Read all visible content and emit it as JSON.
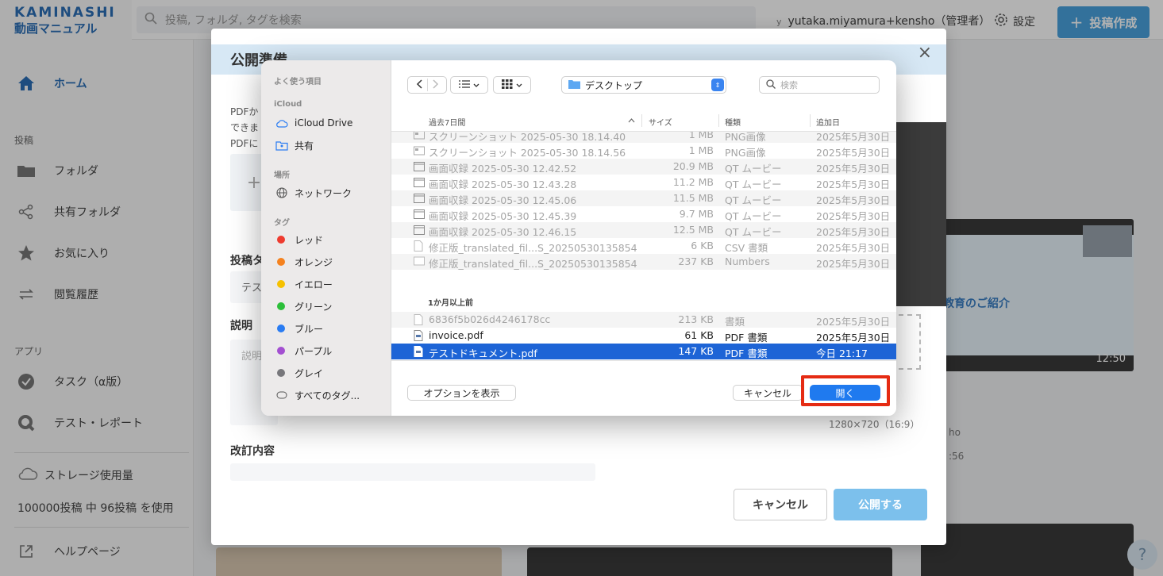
{
  "app": {
    "brand_name": "KAMINASHI",
    "brand_sub": "動画マニュアル",
    "search_placeholder": "投稿, フォルダ, タグを検索",
    "user_prefix": "y",
    "user": "yutaka.miyamura+kensho（管理者）",
    "settings_label": "設定",
    "post_button": "投稿作成",
    "help_label": "?"
  },
  "sidebar": {
    "home": "ホーム",
    "section_posts": "投稿",
    "folder": "フォルダ",
    "shared_folder": "共有フォルダ",
    "favorites": "お気に入り",
    "history": "閲覧履歴",
    "section_apps": "アプリ",
    "task": "タスク（α版）",
    "test_report": "テスト・レポート",
    "storage_label": "ストレージ使用量",
    "storage_usage": "100000投稿 中 96投稿 を使用",
    "help_page": "ヘルプページ"
  },
  "modal": {
    "title": "公開準備",
    "desc_line1": "PDFか",
    "desc_line2": "できま",
    "desc_line3": "PDFに",
    "upload_plus": "+",
    "post_tag_label": "投稿タ",
    "post_tag_value": "テス",
    "description_label": "説明",
    "description_placeholder": "説明",
    "revision_label": "改訂内容",
    "cancel": "キャンセル",
    "publish": "公開する",
    "resolution": "1280×720（16:9）",
    "close": "×"
  },
  "background": {
    "slide_text": "教育のご紹介",
    "duration": "12:50",
    "extra1": "ho",
    "extra2": ":56"
  },
  "dialog": {
    "favorites_section": "よく使う項目",
    "icloud_section": "iCloud",
    "icloud_drive": "iCloud Drive",
    "shared": "共有",
    "locations_section": "場所",
    "network": "ネットワーク",
    "tags_section": "タグ",
    "tags": [
      {
        "label": "レッド",
        "color": "#ee3b2f"
      },
      {
        "label": "オレンジ",
        "color": "#f5821f"
      },
      {
        "label": "イエロー",
        "color": "#f6c100"
      },
      {
        "label": "グリーン",
        "color": "#2cbf3a"
      },
      {
        "label": "ブルー",
        "color": "#2a7cf2"
      },
      {
        "label": "パープル",
        "color": "#a34fd1"
      },
      {
        "label": "グレイ",
        "color": "#77777b"
      }
    ],
    "all_tags": "すべてのタグ...",
    "location": "デスクトップ",
    "search_placeholder": "検索",
    "columns": {
      "name": "過去7日間",
      "size": "サイズ",
      "kind": "種類",
      "date": "追加日"
    },
    "group_recent_rows": [
      {
        "name": "スクリーンショット 2025-05-30 18.14.40",
        "size": "1 MB",
        "kind": "PNG画像",
        "date": "2025年5月30日",
        "icon": "image-icon"
      },
      {
        "name": "スクリーンショット 2025-05-30 18.14.56",
        "size": "1 MB",
        "kind": "PNG画像",
        "date": "2025年5月30日",
        "icon": "image-icon"
      },
      {
        "name": "画面収録 2025-05-30 12.42.52",
        "size": "20.9 MB",
        "kind": "QT ムービー",
        "date": "2025年5月30日",
        "icon": "movie-icon"
      },
      {
        "name": "画面収録 2025-05-30 12.43.28",
        "size": "11.2 MB",
        "kind": "QT ムービー",
        "date": "2025年5月30日",
        "icon": "movie-icon"
      },
      {
        "name": "画面収録 2025-05-30 12.45.06",
        "size": "11.5 MB",
        "kind": "QT ムービー",
        "date": "2025年5月30日",
        "icon": "movie-icon"
      },
      {
        "name": "画面収録 2025-05-30 12.45.39",
        "size": "9.7 MB",
        "kind": "QT ムービー",
        "date": "2025年5月30日",
        "icon": "movie-icon"
      },
      {
        "name": "画面収録 2025-05-30 12.46.15",
        "size": "12.5 MB",
        "kind": "QT ムービー",
        "date": "2025年5月30日",
        "icon": "movie-icon"
      },
      {
        "name": "修正版_translated_fil...S_20250530135854",
        "size": "6 KB",
        "kind": "CSV 書類",
        "date": "2025年5月30日",
        "icon": "document-icon"
      },
      {
        "name": "修正版_translated_fil...S_20250530135854",
        "size": "237 KB",
        "kind": "Numbers",
        "date": "2025年5月30日",
        "icon": "numbers-icon"
      }
    ],
    "group_older": "1か月以上前",
    "group_older_rows": [
      {
        "name": "6836f5b026d4246178cc",
        "size": "213 KB",
        "kind": "書類",
        "date": "2025年5月30日",
        "icon": "document-icon"
      },
      {
        "name": "invoice.pdf",
        "size": "61 KB",
        "kind": "PDF 書類",
        "date": "2025年5月30日",
        "icon": "pdf-icon"
      },
      {
        "name": "テストドキュメント.pdf",
        "size": "147 KB",
        "kind": "PDF 書類",
        "date": "今日 21:17",
        "icon": "pdf-icon"
      }
    ],
    "options_button": "オプションを表示",
    "cancel_button": "キャンセル",
    "open_button": "開く"
  }
}
